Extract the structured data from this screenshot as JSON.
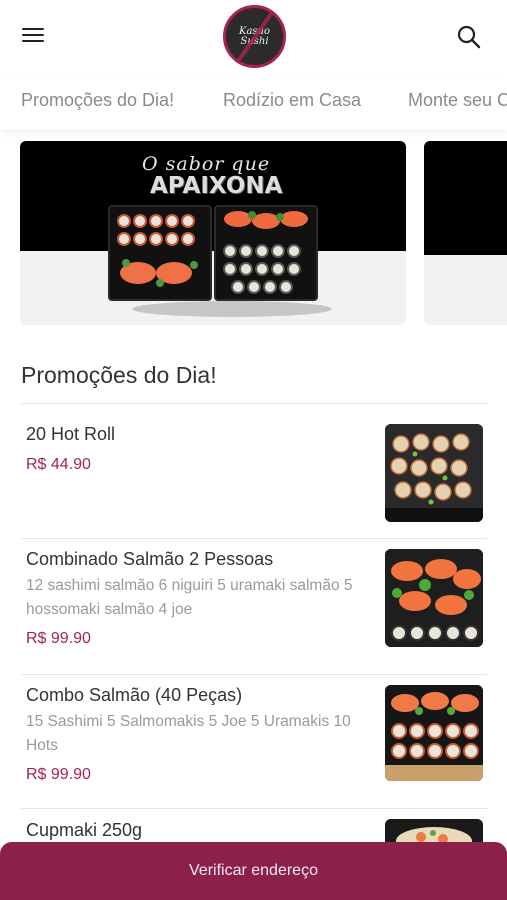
{
  "header": {
    "logo_line1": "Kasuo",
    "logo_line2": "Sushi"
  },
  "tabs": [
    {
      "label": "Promoções do Dia!"
    },
    {
      "label": "Rodízio em Casa"
    },
    {
      "label": "Monte seu C"
    }
  ],
  "banner": {
    "script_text": "O sabor que",
    "headline": "APAIXONA"
  },
  "section": {
    "title": "Promoções do Dia!"
  },
  "items": [
    {
      "name": "20 Hot Roll",
      "description": "",
      "price": "R$ 44.90"
    },
    {
      "name": "Combinado Salmão 2 Pessoas",
      "description": "12 sashimi salmão 6 niguiri 5 uramaki salmão 5 hossomaki salmão 4 joe",
      "price": "R$ 99.90"
    },
    {
      "name": "Combo Salmão (40 Peças)",
      "description": "15 Sashimi 5 Salmomakis 5 Joe 5 Uramakis 10 Hots",
      "price": "R$ 99.90"
    },
    {
      "name": "Cupmaki 250g",
      "description": "",
      "price": ""
    }
  ],
  "cta": {
    "label": "Verificar endereço"
  },
  "colors": {
    "accent": "#a6244d",
    "cta_bg": "#8b2148",
    "text": "#333333",
    "muted": "#9a9a9a"
  },
  "icons": [
    "menu-icon",
    "search-icon"
  ]
}
